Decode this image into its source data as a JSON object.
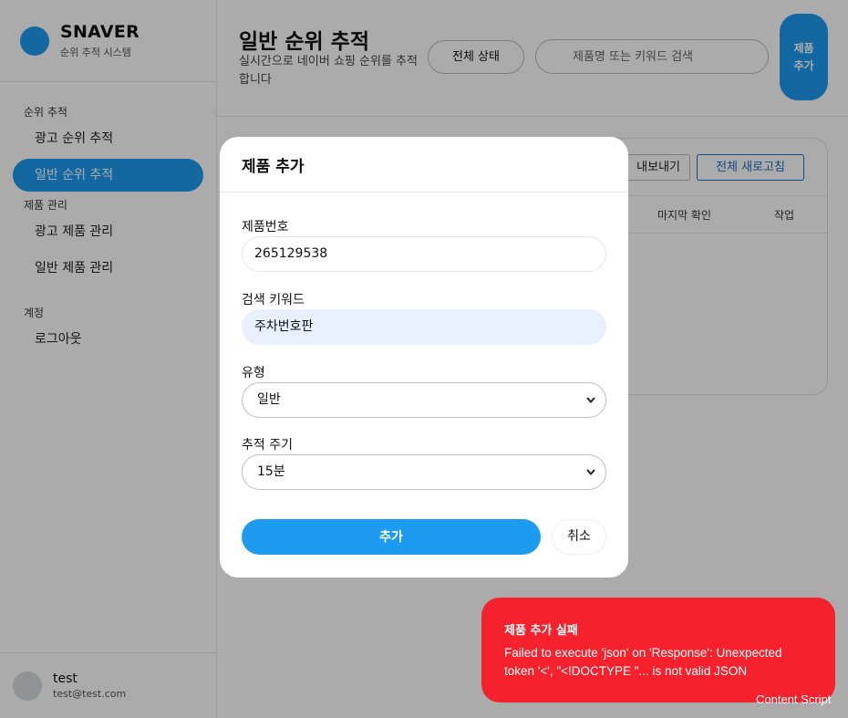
{
  "brand": {
    "name": "SNAVER",
    "subtitle": "순위 추적 시스템"
  },
  "sidebar": {
    "groups": [
      {
        "heading": "순위 추적",
        "items": [
          {
            "label": "광고 순위 추적"
          },
          {
            "label": "일반 순위 추적",
            "active": true
          }
        ]
      },
      {
        "heading": "제품 관리",
        "items": [
          {
            "label": "광고 제품 관리"
          },
          {
            "label": "일반 제품 관리"
          }
        ]
      },
      {
        "heading": "계정",
        "items": [
          {
            "label": "로그아웃"
          }
        ]
      }
    ]
  },
  "user": {
    "name": "test",
    "email": "test@test.com"
  },
  "header": {
    "title": "일반 순위 추적",
    "description": "실시간으로 네이버 쇼핑 순위를 추적합니다",
    "status_filter": "전체 상태",
    "search_placeholder": "제품명 또는 키워드 검색",
    "add_button": "제품 추가"
  },
  "card": {
    "export_label": "내보내기",
    "refresh_label": "전체 새로고침",
    "columns": {
      "last_checked": "마지막 확인",
      "action": "작업"
    }
  },
  "modal": {
    "title": "제품 추가",
    "fields": {
      "product_number": {
        "label": "제품번호",
        "value": "265129538"
      },
      "keyword": {
        "label": "검색 키워드",
        "value": "주차번호판"
      },
      "type": {
        "label": "유형",
        "value": "일반"
      },
      "interval": {
        "label": "추적 주기",
        "value": "15분"
      }
    },
    "submit_label": "추가",
    "cancel_label": "취소"
  },
  "toast": {
    "title": "제품 추가 실패",
    "message": "Failed to execute 'json' on 'Response': Unexpected token '<', \"<!DOCTYPE \"... is not valid JSON",
    "color": "#f5222d"
  },
  "footer_label": "Content Script",
  "colors": {
    "accent": "#1d9bf0",
    "error": "#f5222d"
  }
}
